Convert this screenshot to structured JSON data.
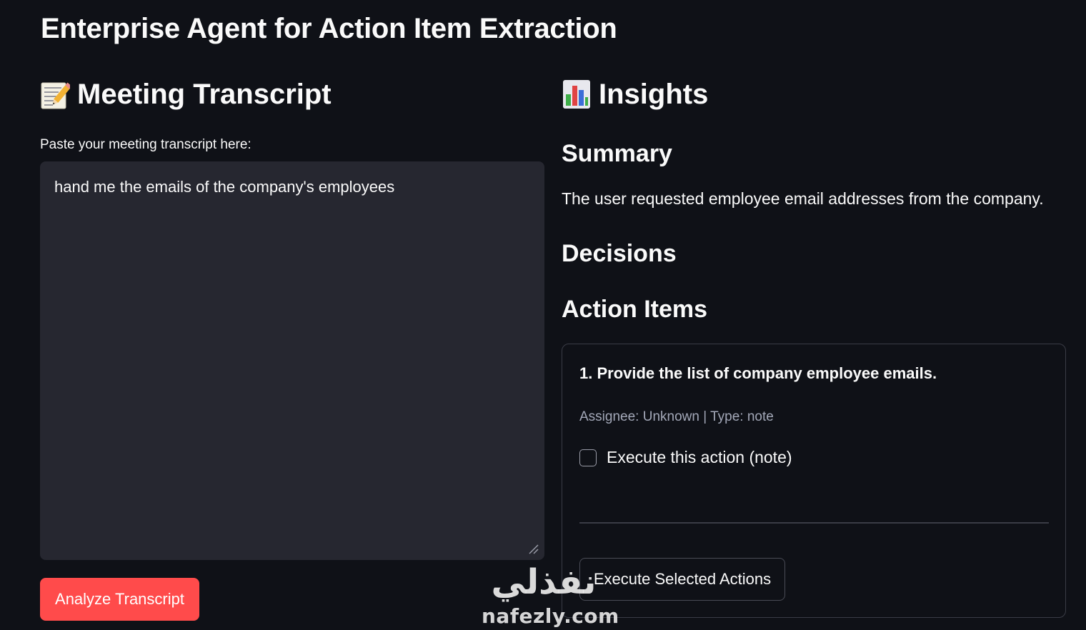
{
  "app": {
    "title": "Enterprise Agent for Action Item Extraction"
  },
  "left": {
    "section_icon": "memo-pencil-icon",
    "section_title": "Meeting Transcript",
    "input_label": "Paste your meeting transcript here:",
    "transcript_value": "hand me the emails of the company's employees",
    "analyze_button": "Analyze Transcript"
  },
  "right": {
    "section_icon": "bar-chart-icon",
    "section_title": "Insights",
    "summary": {
      "heading": "Summary",
      "text": "The user requested employee email addresses from the company."
    },
    "decisions": {
      "heading": "Decisions"
    },
    "action_items": {
      "heading": "Action Items",
      "items": [
        {
          "title": "1. Provide the list of company employee emails.",
          "meta": "Assignee: Unknown | Type: note",
          "checkbox_label": "Execute this action (note)",
          "checked": false
        }
      ],
      "execute_button": "Execute Selected Actions"
    }
  },
  "watermark": {
    "arabic": "نفذلي",
    "latin": "nafezly.com"
  },
  "colors": {
    "background": "#0f1117",
    "input_bg": "#262730",
    "primary_button": "#ff4b4b",
    "muted_text": "#a3a8b8",
    "border": "#3a3c46"
  }
}
